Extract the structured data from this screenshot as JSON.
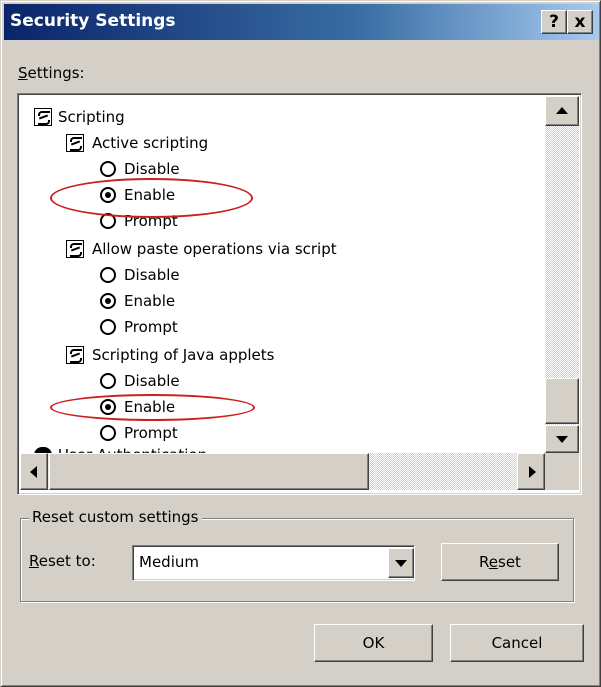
{
  "window": {
    "title": "Security Settings",
    "help_button": "?",
    "close_button": "x"
  },
  "settings_label": "Settings:",
  "tree": {
    "scripting": "Scripting",
    "active_scripting": "Active scripting",
    "allow_paste": "Allow paste operations via script",
    "java_applets": "Scripting of Java applets",
    "user_authentication": "User Authentication",
    "option_disable": "Disable",
    "option_enable": "Enable",
    "option_prompt": "Prompt"
  },
  "reset_group": {
    "legend": "Reset custom settings",
    "reset_to_label": "Reset to:",
    "selected_value": "Medium",
    "reset_button": "Reset"
  },
  "buttons": {
    "ok": "OK",
    "cancel": "Cancel"
  },
  "colors": {
    "highlight_ellipse": "#cc1f1f",
    "titlebar_start": "#0a246a",
    "dialog_face": "#d4d0c8"
  }
}
